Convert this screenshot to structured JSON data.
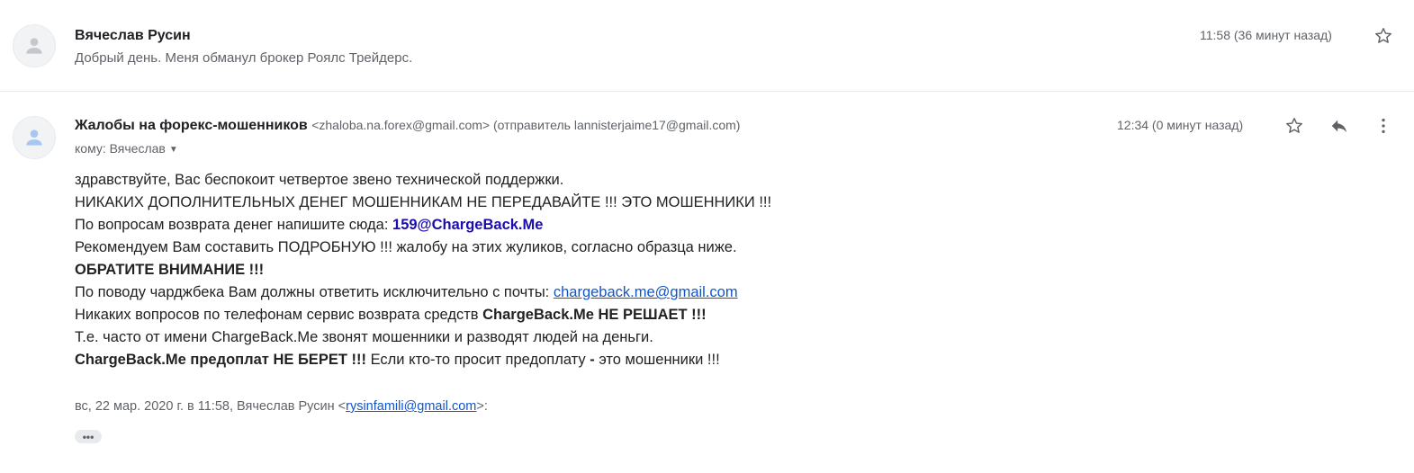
{
  "message1": {
    "sender": "Вячеслав Русин",
    "snippet": "Добрый день. Меня обманул брокер Роялс Трейдерс.",
    "time": "11:58 (36 минут назад)",
    "icons": [
      "person-icon",
      "star-icon"
    ]
  },
  "message2": {
    "sender": "Жалобы на форекс-мошенников",
    "sender_addr": "<zhaloba.na.forex@gmail.com> (отправитель lannisterjaime17@gmail.com)",
    "to": "кому: Вячеслав",
    "time": "12:34 (0 минут назад)",
    "icons": [
      "person-icon",
      "star-icon",
      "reply-icon",
      "more-vert-icon",
      "chevron-down-icon"
    ],
    "body": {
      "l1": "здравствуйте, Вас беспокоит четвертое звено технической поддержки.",
      "l2": "НИКАКИХ ДОПОЛНИТЕЛЬНЫХ ДЕНЕГ МОШЕННИКАМ НЕ ПЕРЕДАВАЙТЕ !!! ЭТО МОШЕННИКИ !!!",
      "l3_text": "По вопросам возврата денег напишите сюда: ",
      "l3_link": "159@ChargeBack.Me",
      "l4": "Рекомендуем Вам составить ПОДРОБНУЮ !!! жалобу на этих жуликов, согласно образца ниже.",
      "l5": "ОБРАТИТЕ ВНИМАНИЕ !!!",
      "l6_text": "По поводу чарджбека Вам должны ответить исключительно с почты: ",
      "l6_link": "chargeback.me@gmail.com",
      "l7_text": "Никаких вопросов по телефонам сервис возврата средств ",
      "l7_bold": "ChargeBack.Me НЕ РЕШАЕТ !!!",
      "l8": "Т.е. часто от имени ChargeBack.Me звонят мошенники и разводят людей на деньги.",
      "l9_bold": "ChargeBack.Me предоплат НЕ БЕРЕТ !!!",
      "l9_text": " Если кто-то просит предоплату ",
      "l9_dash": "-",
      "l9_end": " это мошенники !!!"
    },
    "quote": {
      "prefix": "вс, 22 мар. 2020 г. в 11:58, Вячеслав Русин <",
      "email": "rysinfamili@gmail.com",
      "suffix": ">:"
    },
    "show_trimmed": "•••"
  },
  "colors": {
    "link": "#1a0dab",
    "underline_link": "#1155cc",
    "muted": "#5f6368",
    "divider": "#e8eaed"
  }
}
